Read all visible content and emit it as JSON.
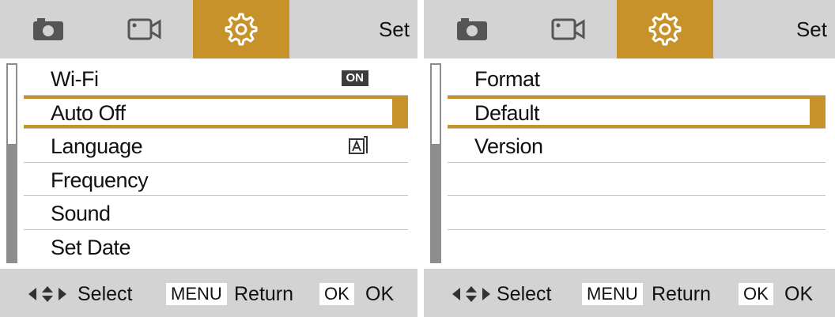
{
  "colors": {
    "accent": "#c8922a",
    "bar_gray": "#d3d3d3",
    "scroll_gray": "#8d8d8d"
  },
  "left": {
    "header": {
      "tabs": [
        {
          "icon": "camera-icon"
        },
        {
          "icon": "video-icon"
        },
        {
          "icon": "gear-icon",
          "active": true
        }
      ],
      "title": "Set"
    },
    "menu": [
      {
        "label": "Wi-Fi",
        "value": "ON"
      },
      {
        "label": "Auto Off",
        "selected": true
      },
      {
        "label": "Language",
        "value_icon": "auto-language-icon"
      },
      {
        "label": "Frequency"
      },
      {
        "label": "Sound"
      },
      {
        "label": "Set Date"
      }
    ],
    "footer": {
      "select": "Select",
      "menu_key": "MENU",
      "return": "Return",
      "ok_key": "OK",
      "ok": "OK"
    }
  },
  "right": {
    "header": {
      "tabs": [
        {
          "icon": "camera-icon"
        },
        {
          "icon": "video-icon"
        },
        {
          "icon": "gear-icon",
          "active": true
        }
      ],
      "title": "Set"
    },
    "menu": [
      {
        "label": "Format"
      },
      {
        "label": "Default",
        "selected": true
      },
      {
        "label": "Version"
      },
      {
        "label": ""
      },
      {
        "label": ""
      },
      {
        "label": ""
      }
    ],
    "footer": {
      "select": "Select",
      "menu_key": "MENU",
      "return": "Return",
      "ok_key": "OK",
      "ok": "OK"
    }
  }
}
